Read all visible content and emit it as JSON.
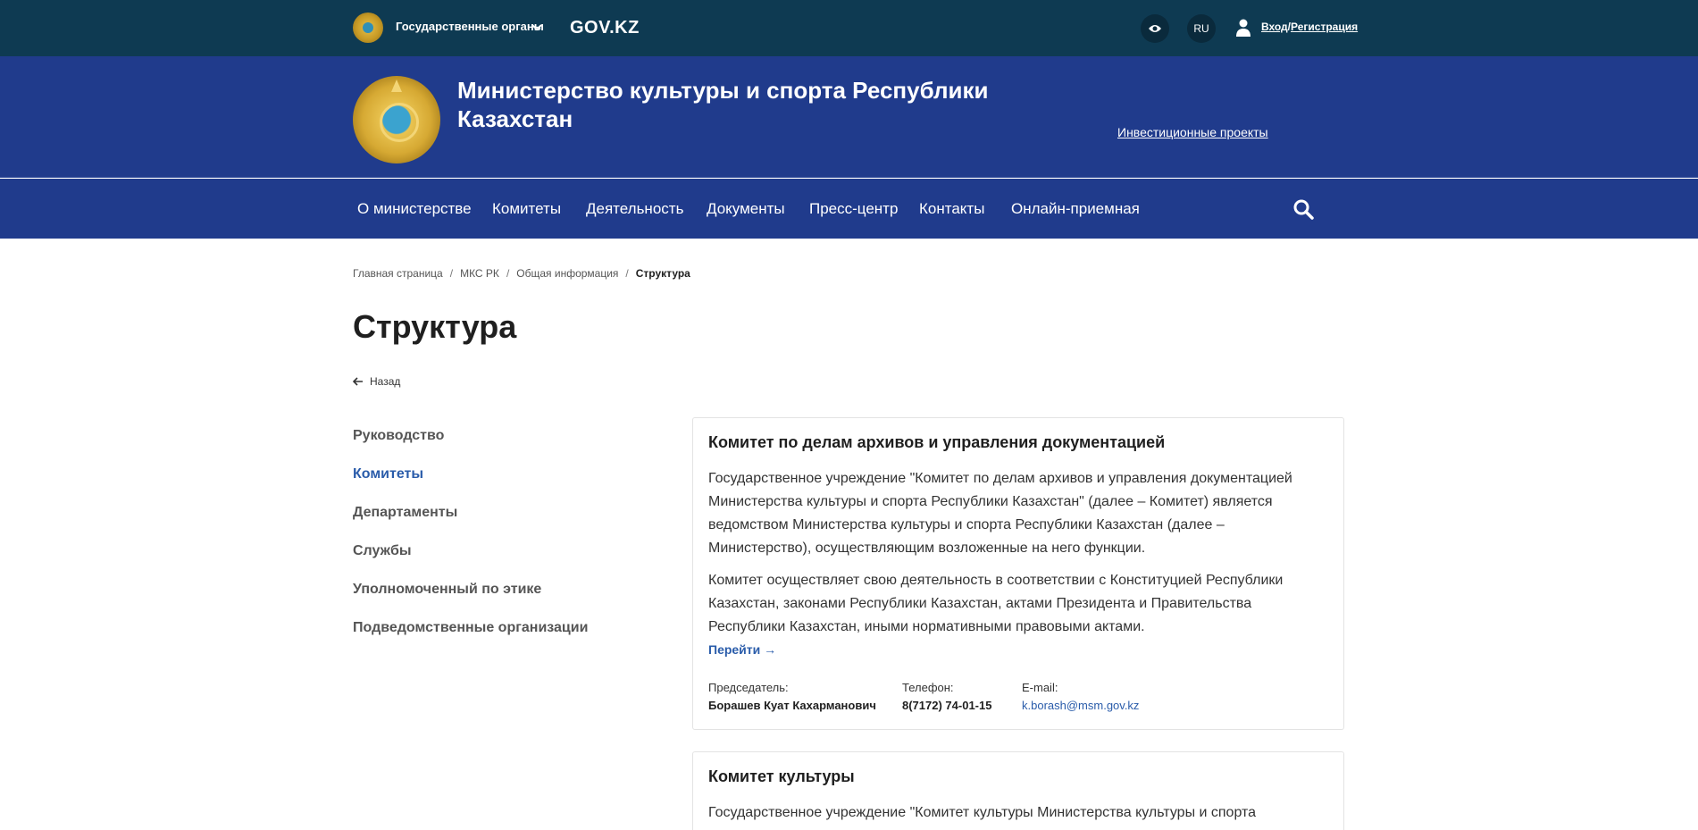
{
  "topbar": {
    "gov_organs": "Государственные органы",
    "govkz": "GOV.KZ",
    "lang": "RU",
    "login": "Вход",
    "login_sep": "/",
    "register": "Регистрация"
  },
  "header": {
    "title": "Министерство культуры и спорта Республики Казахстан",
    "invest_link": "Инвестиционные проекты"
  },
  "nav": {
    "items": [
      "О министерстве",
      "Комитеты",
      "Деятельность",
      "Документы",
      "Пресс-центр",
      "Контакты",
      "Онлайн-приемная"
    ]
  },
  "breadcrumb": {
    "items": [
      "Главная страница",
      "МКС РК",
      "Общая информация"
    ],
    "separator": "/",
    "current": "Структура"
  },
  "page": {
    "title": "Структура",
    "back": "Назад"
  },
  "sidebar": {
    "items": [
      {
        "label": "Руководство",
        "active": false
      },
      {
        "label": "Комитеты",
        "active": true
      },
      {
        "label": "Департаменты",
        "active": false
      },
      {
        "label": "Службы",
        "active": false
      },
      {
        "label": "Уполномоченный по этике",
        "active": false
      },
      {
        "label": "Подведомственные организации",
        "active": false
      }
    ]
  },
  "cards": [
    {
      "title": "Комитет по делам архивов и управления документацией",
      "para1": "Государственное учреждение \"Комитет по делам архивов и управления документацией Министерства культуры и спорта Республики Казахстан\" (далее – Комитет) является ведомством Министерства культуры и спорта Республики Казахстан (далее – Министерство), осуществляющим возложенные на него функции.",
      "para2": "Комитет осуществляет свою деятельность в соответствии с Конституцией Республики Казахстан, законами Республики Казахстан, актами Президента и Правительства Республики Казахстан, иными нормативными правовыми актами.",
      "goto": "Перейти →",
      "chair_label": "Председатель:",
      "chair": "Борашев Куат Кахарманович",
      "phone_label": "Телефон:",
      "phone": "8(7172) 74-01-15",
      "email_label": "E-mail:",
      "email": "k.borash@msm.gov.kz"
    },
    {
      "title": "Комитет культуры",
      "para1": "Государственное учреждение \"Комитет культуры Министерства культуры и спорта"
    }
  ],
  "colors": {
    "topbar": "#0e3a52",
    "header": "#203b8c",
    "accent_link": "#2a5caa"
  }
}
